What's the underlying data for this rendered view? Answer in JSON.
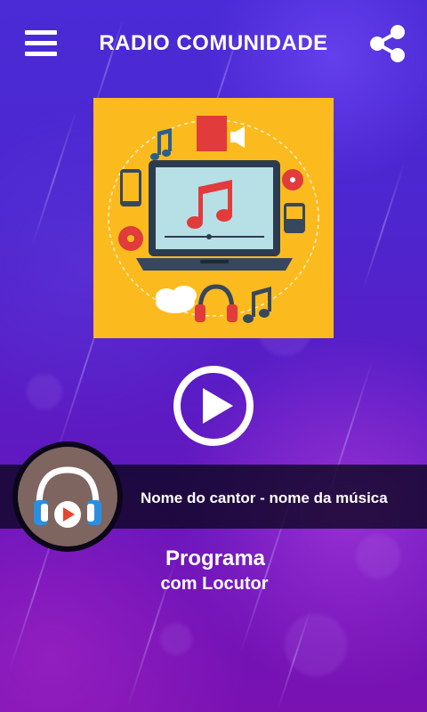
{
  "header": {
    "title": "RADIO COMUNIDADE",
    "menu_icon": "hamburger-menu-icon",
    "share_icon": "share-icon"
  },
  "artwork": {
    "icon": "laptop-music-artwork",
    "background_color": "#fbbb1e"
  },
  "player": {
    "play_icon": "play-icon",
    "track": "Nome do cantor - nome da música",
    "logo_icon": "headphones-play-icon"
  },
  "program": {
    "title": "Programa",
    "host": "com Locutor"
  },
  "colors": {
    "background_top": "#4a2bd6",
    "background_bottom": "#7a12b2",
    "bar": "#0a051e",
    "logo_circle": "#7e6560",
    "headphone_blue": "#2b8fe0",
    "play_red": "#e8452e"
  }
}
